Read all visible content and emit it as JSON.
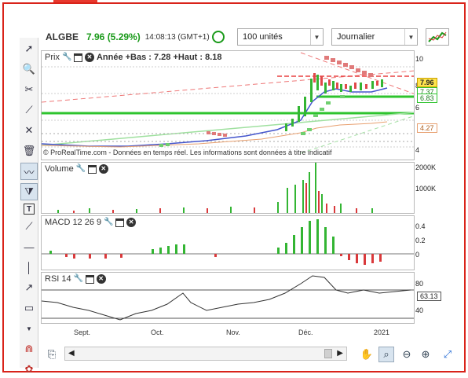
{
  "toolbar": {
    "symbol": "ALGBE",
    "price": "7.96 (5.29%)",
    "time": "14:08:13 (GMT+1)",
    "quantity": "100 unités",
    "period": "Journalier"
  },
  "price_panel": {
    "title": "Prix",
    "info": "Année +Bas : 7.28 +Haut : 8.18",
    "watermark": "© ProRealTime.com - Données en temps réel. Les informations sont données à titre indicatif",
    "axis": [
      "10",
      "8",
      "6",
      "4"
    ],
    "tags": {
      "last": "7.96",
      "t1": "7.37",
      "t2": "6.83",
      "t3": "4.27"
    }
  },
  "volume_panel": {
    "title": "Volume",
    "axis": [
      "2000K",
      "1000K"
    ]
  },
  "macd_panel": {
    "title": "MACD 12 26 9",
    "axis": [
      "0.4",
      "0.2",
      "0"
    ]
  },
  "rsi_panel": {
    "title": "RSI 14",
    "axis": [
      "80",
      "63.13",
      "40"
    ]
  },
  "xaxis": [
    "Sept.",
    "Oct.",
    "Nov.",
    "Déc.",
    "2021"
  ],
  "colors": {
    "up": "#33b533",
    "down": "#d9393b",
    "accent": "#e8392e"
  },
  "icons": [
    "pointer-icon",
    "zoom-icon",
    "scissors-icon",
    "line-icon",
    "trash-icon",
    "text-icon",
    "magnet-icon"
  ]
}
